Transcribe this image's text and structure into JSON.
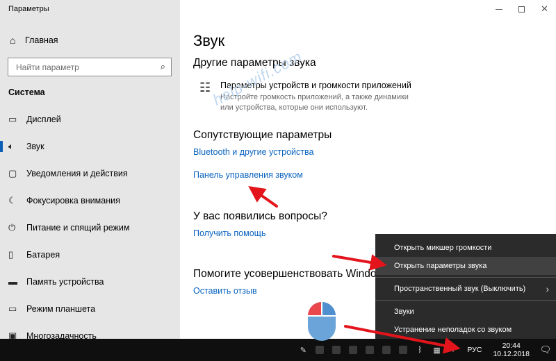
{
  "window": {
    "title": "Параметры"
  },
  "sidebar": {
    "home_label": "Главная",
    "search_placeholder": "Найти параметр",
    "section_title": "Система",
    "items": [
      {
        "label": "Дисплей",
        "icon": "display-icon"
      },
      {
        "label": "Звук",
        "icon": "speaker-icon",
        "active": true
      },
      {
        "label": "Уведомления и действия",
        "icon": "notifications-icon"
      },
      {
        "label": "Фокусировка внимания",
        "icon": "moon-icon"
      },
      {
        "label": "Питание и спящий режим",
        "icon": "power-icon"
      },
      {
        "label": "Батарея",
        "icon": "battery-icon"
      },
      {
        "label": "Память устройства",
        "icon": "storage-icon"
      },
      {
        "label": "Режим планшета",
        "icon": "tablet-icon"
      },
      {
        "label": "Многозадачность",
        "icon": "multitasking-icon"
      }
    ]
  },
  "main": {
    "page_title": "Звук",
    "other_params_heading": "Другие параметры звука",
    "mixer_title": "Параметры устройств и громкости приложений",
    "mixer_desc": "Настройте громкость приложений, а также динамики или устройства, которые они используют.",
    "related_heading": "Сопутствующие параметры",
    "bluetooth_link": "Bluetooth и другие устройства",
    "sound_panel_link": "Панель управления звуком",
    "questions_heading": "У вас появились вопросы?",
    "help_link": "Получить помощь",
    "improve_heading": "Помогите усовершенствовать Windows",
    "feedback_link": "Оставить отзыв"
  },
  "watermark": "help-wifi.com",
  "context_menu": {
    "items": [
      "Открыть микшер громкости",
      "Открыть параметры звука",
      "Пространственный звук (Выключить)",
      "Звуки",
      "Устранение неполадок со звуком"
    ]
  },
  "taskbar": {
    "language": "РУС",
    "time": "20:44",
    "date": "10.12.2018"
  },
  "colors": {
    "accent_link": "#0b64c0",
    "sidebar_bg": "#e6e6e6",
    "menu_bg": "#2b2b2b",
    "annotation_arrow": "#e3141b"
  }
}
